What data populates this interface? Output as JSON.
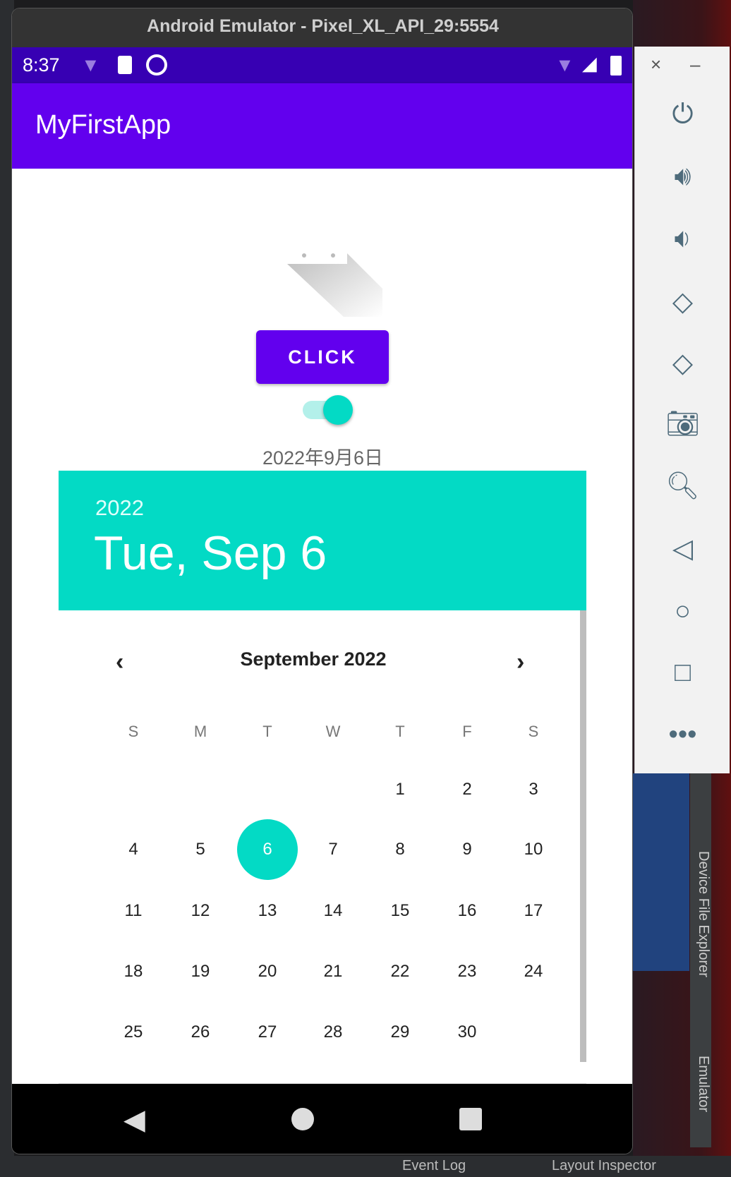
{
  "window": {
    "title": "Android Emulator - Pixel_XL_API_29:5554"
  },
  "status_bar": {
    "time": "8:37"
  },
  "app": {
    "title": "MyFirstApp"
  },
  "main": {
    "button_label": "CLICK",
    "switch_on": true,
    "date_text": "2022年9月6日"
  },
  "date_picker": {
    "header_year": "2022",
    "header_date": "Tue, Sep 6",
    "month_label": "September 2022",
    "weekdays": [
      "S",
      "M",
      "T",
      "W",
      "T",
      "F",
      "S"
    ],
    "first_weekday_index": 4,
    "days": [
      "1",
      "2",
      "3",
      "4",
      "5",
      "6",
      "7",
      "8",
      "9",
      "10",
      "11",
      "12",
      "13",
      "14",
      "15",
      "16",
      "17",
      "18",
      "19",
      "20",
      "21",
      "22",
      "23",
      "24",
      "25",
      "26",
      "27",
      "28",
      "29",
      "30"
    ],
    "selected_day": "6",
    "accent": "#03dac5"
  },
  "colors": {
    "primary": "#6200ee",
    "primary_dark": "#3700b3",
    "accent": "#03dac5"
  },
  "side_panel": {
    "icons": [
      "close-icon",
      "minimize-icon",
      "power-icon",
      "volume-up-icon",
      "volume-down-icon",
      "rotate-left-icon",
      "rotate-right-icon",
      "camera-icon",
      "zoom-icon",
      "back-icon",
      "home-icon",
      "overview-icon",
      "more-icon"
    ]
  },
  "ide": {
    "tool_device_file_explorer": "Device File Explorer",
    "tool_emulator": "Emulator",
    "event_log": "Event Log",
    "layout_inspector": "Layout Inspector"
  }
}
